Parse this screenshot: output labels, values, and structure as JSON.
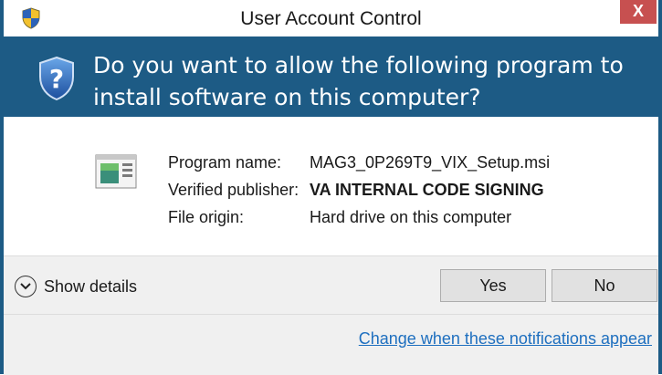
{
  "window": {
    "title": "User Account Control",
    "close_label": "X"
  },
  "header": {
    "question": "Do you want to allow the following program to install software on this computer?"
  },
  "program": {
    "rows": [
      {
        "label": "Program name:",
        "value": "MAG3_0P269T9_VIX_Setup.msi"
      },
      {
        "label": "Verified publisher:",
        "value": "VA INTERNAL CODE SIGNING"
      },
      {
        "label": "File origin:",
        "value": "Hard drive on this computer"
      }
    ]
  },
  "footer": {
    "show_details": "Show details",
    "yes": "Yes",
    "no": "No",
    "change_link": "Change when these notifications appear"
  },
  "colors": {
    "header_bg": "#1d5b85",
    "close_bg": "#c75050",
    "link": "#1e6fbf"
  },
  "icons": [
    "uac-shield-icon",
    "question-shield-icon",
    "installer-package-icon",
    "chevron-down-icon"
  ]
}
